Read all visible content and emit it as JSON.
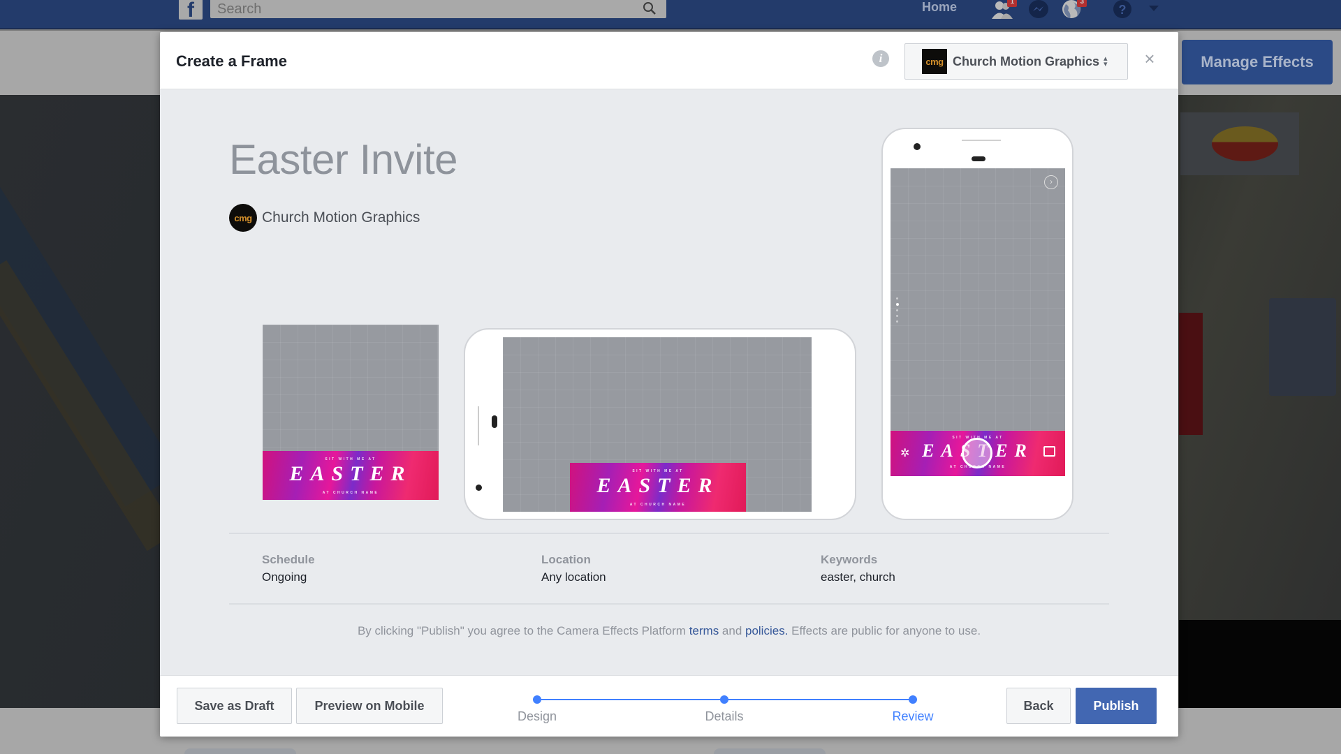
{
  "topbar": {
    "logo": "f",
    "search_placeholder": "Search",
    "home_label": "Home",
    "friend_requests_badge": "1",
    "notifications_badge": "3"
  },
  "background": {
    "manage_effects_label": "Manage Effects"
  },
  "modal": {
    "title": "Create a Frame",
    "page_selector": {
      "logo_text": "cmg",
      "selected_page": "Church Motion Graphics"
    },
    "close_label": "×",
    "effect": {
      "name": "Easter Invite",
      "owner_avatar_text": "cmg",
      "owner_name": "Church Motion Graphics",
      "frame_art": {
        "top_line": "SIT WITH ME AT",
        "headline": "EASTER",
        "bottom_line": "AT CHURCH NAME"
      }
    },
    "details": [
      {
        "label": "Schedule",
        "value": "Ongoing"
      },
      {
        "label": "Location",
        "value": "Any location"
      },
      {
        "label": "Keywords",
        "value": "easter, church"
      }
    ],
    "legal": {
      "prefix": "By clicking \"Publish\" you agree to the Camera Effects Platform ",
      "terms_link": "terms",
      "middle": " and ",
      "policies_link": "policies.",
      "suffix": " Effects are public for anyone to use."
    },
    "footer": {
      "save_draft_label": "Save as Draft",
      "preview_mobile_label": "Preview on Mobile",
      "back_label": "Back",
      "publish_label": "Publish",
      "steps": [
        {
          "label": "Design",
          "state": "complete"
        },
        {
          "label": "Details",
          "state": "complete"
        },
        {
          "label": "Review",
          "state": "current"
        }
      ]
    }
  },
  "colors": {
    "fb_blue": "#4267b2",
    "step_blue": "#4080ff",
    "link_blue": "#365899"
  }
}
